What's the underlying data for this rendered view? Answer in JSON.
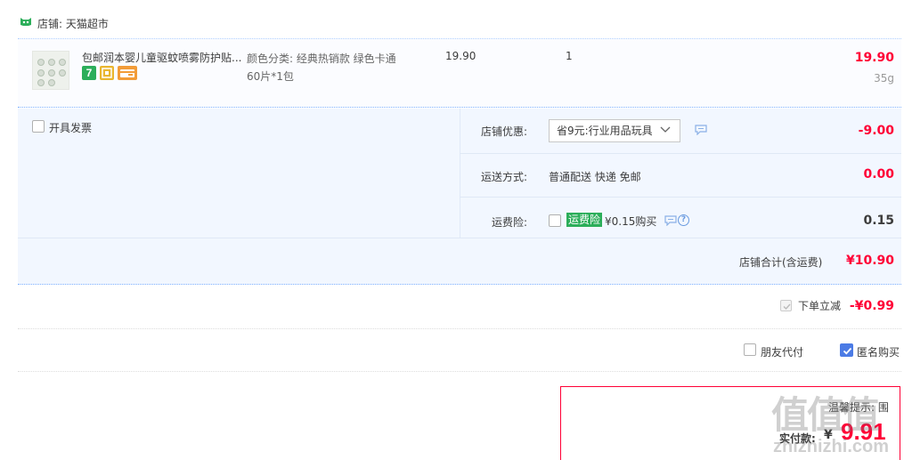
{
  "shop": {
    "label": "店铺: 天猫超市",
    "icon": "tmall-cat-icon"
  },
  "item": {
    "title": "包邮润本婴儿童驱蚊喷雾防护贴...",
    "sku_line1": "颜色分类: 经典热销款 绿色卡通",
    "sku_line2": "60片*1包",
    "price": "19.90",
    "quantity": "1",
    "subtotal": "19.90",
    "weight": "35g",
    "badge_seven": "7"
  },
  "invoice": {
    "label": "开具发票"
  },
  "discount": {
    "label": "店铺优惠:",
    "selected": "省9元:行业用品玩具",
    "value": "-9.00"
  },
  "shipping": {
    "label": "运送方式:",
    "method": "普通配送 快递 免邮",
    "fee": "0.00"
  },
  "insurance": {
    "label": "运费险:",
    "tag": "运费险",
    "price_text": "¥0.15购买",
    "help": "?",
    "value": "0.15"
  },
  "shop_total": {
    "label": "店铺合计(含运费)",
    "value": "¥10.90"
  },
  "instant_discount": {
    "label": "下单立减",
    "value": "-¥0.99"
  },
  "options": {
    "friend_pay": "朋友代付",
    "anonymous": "匿名购买"
  },
  "payment": {
    "hint": "温馨提示: 围",
    "label": "实付款:",
    "currency": "¥",
    "value": "9.91"
  },
  "watermark": {
    "title": "值值值",
    "sub": "zhizhizhi.com"
  },
  "colors": {
    "accent_red": "#ff0036",
    "tmall_green": "#2cae5a",
    "checkbox_blue": "#4b7be5",
    "panel_bg": "#f2f7ff"
  }
}
